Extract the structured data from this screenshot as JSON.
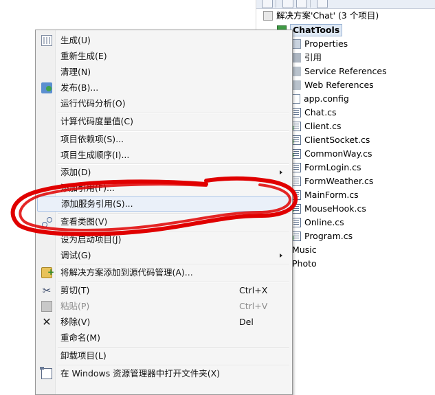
{
  "solution_explorer": {
    "solution_label": "解决方案'Chat' (3 个项目)",
    "project_label": "ChatTools",
    "items": [
      {
        "label": "Properties",
        "icon": "properties-icon"
      },
      {
        "label": "引用",
        "icon": "references-icon"
      },
      {
        "label": "Service References",
        "icon": "service-references-icon"
      },
      {
        "label": "Web References",
        "icon": "web-references-icon"
      },
      {
        "label": "app.config",
        "icon": "config-file-icon"
      },
      {
        "label": "Chat.cs",
        "icon": "cs-file-icon"
      },
      {
        "label": "Client.cs",
        "icon": "cs-file-icon"
      },
      {
        "label": "ClientSocket.cs",
        "icon": "cs-file-icon"
      },
      {
        "label": "CommonWay.cs",
        "icon": "cs-file-icon"
      },
      {
        "label": "FormLogin.cs",
        "icon": "cs-file-icon"
      },
      {
        "label": "FormWeather.cs",
        "icon": "cs-file-icon"
      },
      {
        "label": "MainForm.cs",
        "icon": "cs-file-icon"
      },
      {
        "label": "MouseHook.cs",
        "icon": "cs-file-icon"
      },
      {
        "label": "Online.cs",
        "icon": "cs-file-icon"
      },
      {
        "label": "Program.cs",
        "icon": "cs-file-icon"
      }
    ],
    "extra_projects": [
      "Music",
      "Photo"
    ]
  },
  "context_menu": {
    "items": {
      "build": "生成(U)",
      "rebuild": "重新生成(E)",
      "clean": "清理(N)",
      "publish": "发布(B)...",
      "run_code_analysis": "运行代码分析(O)",
      "calculate_metrics": "计算代码度量值(C)",
      "project_dependencies": "项目依赖项(S)...",
      "project_build_order": "项目生成顺序(I)...",
      "add": "添加(D)",
      "add_reference": "添加引用(F)...",
      "add_service_reference": "添加服务引用(S)...",
      "view_class_diagram": "查看类图(V)",
      "set_startup_project": "设为启动项目(J)",
      "debug": "调试(G)",
      "add_to_source_control": "将解决方案添加到源代码管理(A)...",
      "cut": "剪切(T)",
      "cut_shortcut": "Ctrl+X",
      "paste": "粘贴(P)",
      "paste_shortcut": "Ctrl+V",
      "remove": "移除(V)",
      "remove_shortcut": "Del",
      "rename": "重命名(M)",
      "unload_project": "卸载项目(L)",
      "open_folder_in_explorer": "在 Windows 资源管理器中打开文件夹(X)"
    }
  },
  "colors": {
    "annotation_red": "#e00000",
    "highlight_bg": "#eaf0f9",
    "highlight_border": "#adc7ea",
    "menu_bg": "#f5f5f5"
  }
}
